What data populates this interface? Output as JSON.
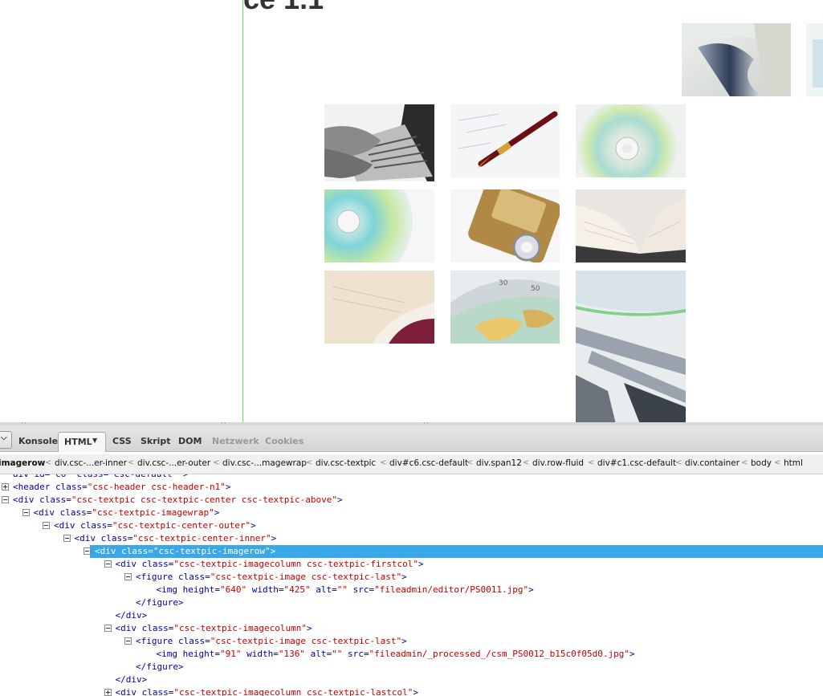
{
  "page": {
    "heading": "ce 1.1"
  },
  "images": [
    {
      "name": "image-metal-clip",
      "alt": ""
    },
    {
      "name": "image-edge-partial",
      "alt": ""
    },
    {
      "name": "image-laptop-typing",
      "alt": ""
    },
    {
      "name": "image-fountain-pen",
      "alt": ""
    },
    {
      "name": "image-cd-disc-1",
      "alt": ""
    },
    {
      "name": "image-cd-disc-2",
      "alt": ""
    },
    {
      "name": "image-padlock-key",
      "alt": ""
    },
    {
      "name": "image-open-book-1",
      "alt": ""
    },
    {
      "name": "image-open-book-2",
      "alt": ""
    },
    {
      "name": "image-globe-map",
      "alt": ""
    },
    {
      "name": "image-cd-drive-tall",
      "alt": ""
    }
  ],
  "firebug": {
    "menu_icon": "chevron-down-icon",
    "tabs": [
      {
        "label": "Konsole",
        "active": false,
        "disabled": false
      },
      {
        "label": "HTML",
        "active": true,
        "disabled": false
      },
      {
        "label": "CSS",
        "active": false,
        "disabled": false
      },
      {
        "label": "Skript",
        "active": false,
        "disabled": false
      },
      {
        "label": "DOM",
        "active": false,
        "disabled": false
      },
      {
        "label": "Netzwerk",
        "active": false,
        "disabled": true
      },
      {
        "label": "Cookies",
        "active": false,
        "disabled": true
      }
    ],
    "breadcrumbs": [
      "imagerow",
      "div.csc-...er-inner",
      "div.csc-...er-outer",
      "div.csc-...magewrap",
      "div.csc-textpic",
      "div#c6.csc-default",
      "div.span12",
      "div.row-fluid",
      "div#c1.csc-default",
      "div.container",
      "body",
      "html"
    ],
    "tree_rows": [
      {
        "indent": 0,
        "twisty": "none",
        "parts": [
          [
            "t",
            "div id=\"c6\" class=\"csc-default\" >"
          ]
        ]
      },
      {
        "indent": 0,
        "twisty": "plus",
        "parts": [
          [
            "t",
            "<header "
          ],
          [
            "a",
            "class="
          ],
          [
            "v",
            "\"csc-header csc-header-n1\""
          ],
          [
            "t",
            ">"
          ]
        ]
      },
      {
        "indent": 0,
        "twisty": "minus",
        "parts": [
          [
            "t",
            "<div "
          ],
          [
            "a",
            "class="
          ],
          [
            "v",
            "\"csc-textpic csc-textpic-center csc-textpic-above\""
          ],
          [
            "t",
            ">"
          ]
        ]
      },
      {
        "indent": 1,
        "twisty": "minus",
        "parts": [
          [
            "t",
            "<div "
          ],
          [
            "a",
            "class="
          ],
          [
            "v",
            "\"csc-textpic-imagewrap\""
          ],
          [
            "t",
            ">"
          ]
        ]
      },
      {
        "indent": 2,
        "twisty": "minus",
        "parts": [
          [
            "t",
            "<div "
          ],
          [
            "a",
            "class="
          ],
          [
            "v",
            "\"csc-textpic-center-outer\""
          ],
          [
            "t",
            ">"
          ]
        ]
      },
      {
        "indent": 3,
        "twisty": "minus",
        "parts": [
          [
            "t",
            "<div "
          ],
          [
            "a",
            "class="
          ],
          [
            "v",
            "\"csc-textpic-center-inner\""
          ],
          [
            "t",
            ">"
          ]
        ]
      },
      {
        "indent": 4,
        "twisty": "minus",
        "selected": true,
        "parts": [
          [
            "t",
            "<div "
          ],
          [
            "a",
            "class="
          ],
          [
            "v",
            "\"csc-textpic-imagerow\""
          ],
          [
            "t",
            ">"
          ]
        ]
      },
      {
        "indent": 5,
        "twisty": "minus",
        "parts": [
          [
            "t",
            "<div "
          ],
          [
            "a",
            "class="
          ],
          [
            "v",
            "\"csc-textpic-imagecolumn csc-textpic-firstcol\""
          ],
          [
            "t",
            ">"
          ]
        ]
      },
      {
        "indent": 6,
        "twisty": "minus",
        "parts": [
          [
            "t",
            "<figure "
          ],
          [
            "a",
            "class="
          ],
          [
            "v",
            "\"csc-textpic-image csc-textpic-last\""
          ],
          [
            "t",
            ">"
          ]
        ]
      },
      {
        "indent": 7,
        "twisty": "none",
        "parts": [
          [
            "t",
            "<img "
          ],
          [
            "a",
            "height="
          ],
          [
            "v",
            "\"640\""
          ],
          [
            "a",
            " width="
          ],
          [
            "v",
            "\"425\""
          ],
          [
            "a",
            " alt="
          ],
          [
            "v",
            "\"\""
          ],
          [
            "a",
            " src="
          ],
          [
            "v",
            "\"fileadmin/editor/PS0011.jpg\""
          ],
          [
            "t",
            ">"
          ]
        ]
      },
      {
        "indent": 6,
        "twisty": "none",
        "parts": [
          [
            "t",
            "</figure>"
          ]
        ]
      },
      {
        "indent": 5,
        "twisty": "none",
        "parts": [
          [
            "t",
            "</div>"
          ]
        ]
      },
      {
        "indent": 5,
        "twisty": "minus",
        "parts": [
          [
            "t",
            "<div "
          ],
          [
            "a",
            "class="
          ],
          [
            "v",
            "\"csc-textpic-imagecolumn\""
          ],
          [
            "t",
            ">"
          ]
        ]
      },
      {
        "indent": 6,
        "twisty": "minus",
        "parts": [
          [
            "t",
            "<figure "
          ],
          [
            "a",
            "class="
          ],
          [
            "v",
            "\"csc-textpic-image csc-textpic-last\""
          ],
          [
            "t",
            ">"
          ]
        ]
      },
      {
        "indent": 7,
        "twisty": "none",
        "parts": [
          [
            "t",
            "<img "
          ],
          [
            "a",
            "height="
          ],
          [
            "v",
            "\"91\""
          ],
          [
            "a",
            " width="
          ],
          [
            "v",
            "\"136\""
          ],
          [
            "a",
            " alt="
          ],
          [
            "v",
            "\"\""
          ],
          [
            "a",
            " src="
          ],
          [
            "v",
            "\"fileadmin/_processed_/csm_PS0012_b15c0f05d0.jpg\""
          ],
          [
            "t",
            ">"
          ]
        ]
      },
      {
        "indent": 6,
        "twisty": "none",
        "parts": [
          [
            "t",
            "</figure>"
          ]
        ]
      },
      {
        "indent": 5,
        "twisty": "none",
        "parts": [
          [
            "t",
            "</div>"
          ]
        ]
      },
      {
        "indent": 5,
        "twisty": "plus",
        "parts": [
          [
            "t",
            "<div "
          ],
          [
            "a",
            "class="
          ],
          [
            "v",
            "\"csc-textpic-imagecolumn csc-textpic-lastcol\""
          ],
          [
            "t",
            ">"
          ]
        ]
      }
    ]
  },
  "colors": {
    "selection": "#3aa8e8",
    "tag": "#0000a8",
    "value": "#c40000",
    "guide_line": "#7ccf6f"
  }
}
